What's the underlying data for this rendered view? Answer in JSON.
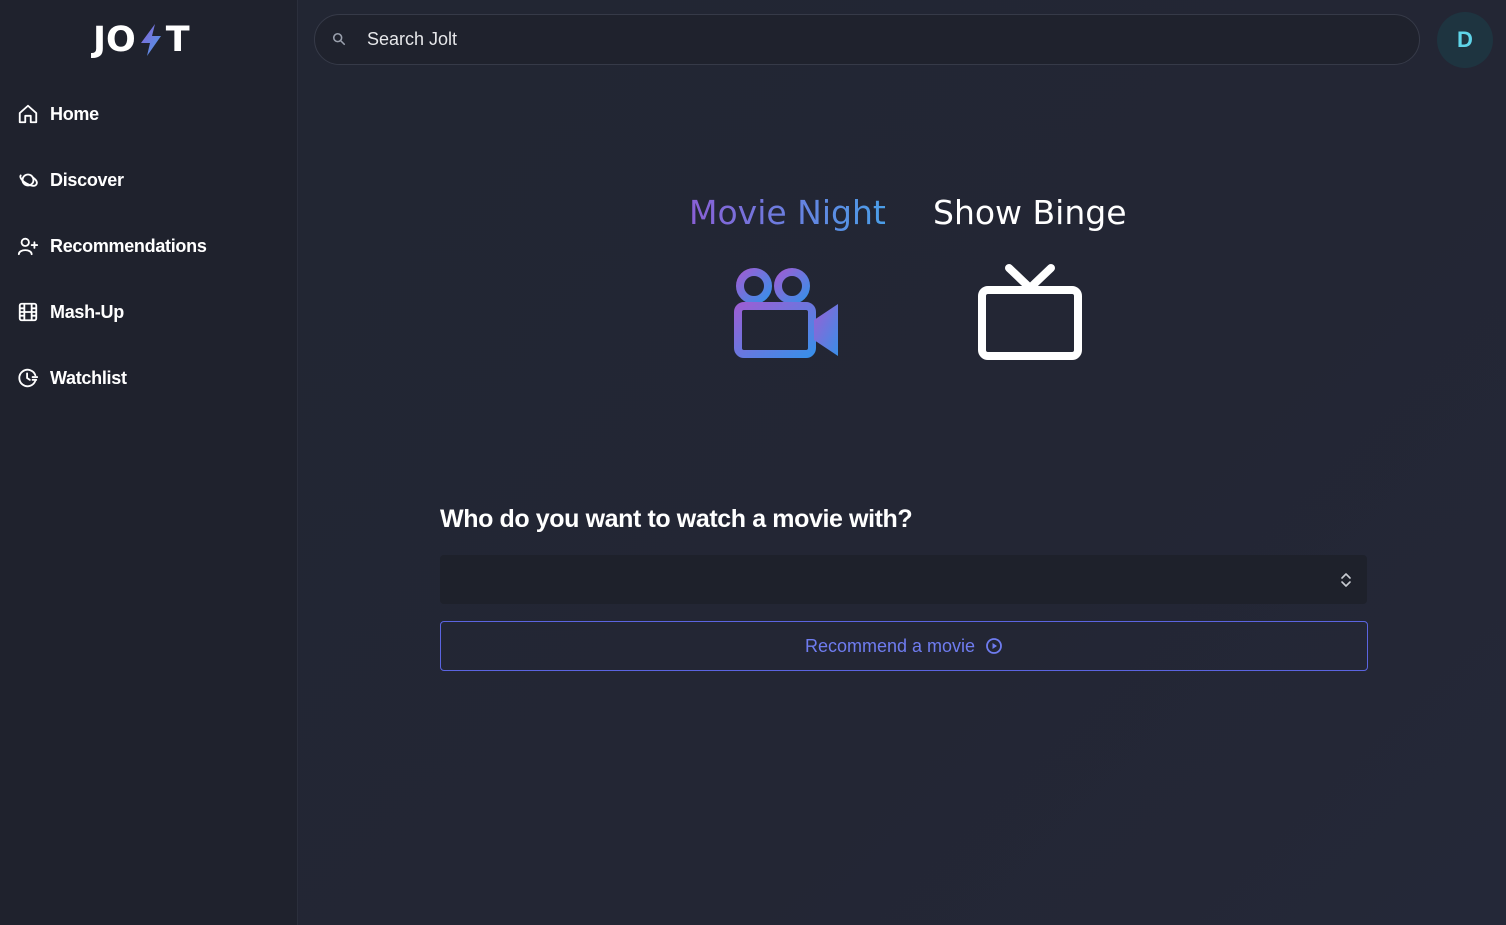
{
  "brand": {
    "logo_left": "JO",
    "logo_right": "T",
    "accent_gradient": [
      "#8a5fd6",
      "#4a9ee8"
    ]
  },
  "sidebar": {
    "items": [
      {
        "label": "Home",
        "icon": "home-icon"
      },
      {
        "label": "Discover",
        "icon": "planet-icon"
      },
      {
        "label": "Recommendations",
        "icon": "user-plus-icon"
      },
      {
        "label": "Mash-Up",
        "icon": "film-icon"
      },
      {
        "label": "Watchlist",
        "icon": "clock-list-icon"
      }
    ]
  },
  "header": {
    "search_placeholder": "Search Jolt",
    "search_value": "",
    "avatar_initial": "D"
  },
  "modes": [
    {
      "label": "Movie Night",
      "icon": "video-camera-icon",
      "active": true
    },
    {
      "label": "Show Binge",
      "icon": "tv-icon",
      "active": false
    }
  ],
  "form": {
    "question": "Who do you want to watch a movie with?",
    "select_value": "",
    "button_label": "Recommend a movie"
  },
  "colors": {
    "accent_button": "#6f7cf0",
    "avatar_text": "#5fd4e8",
    "background": "#222633"
  }
}
